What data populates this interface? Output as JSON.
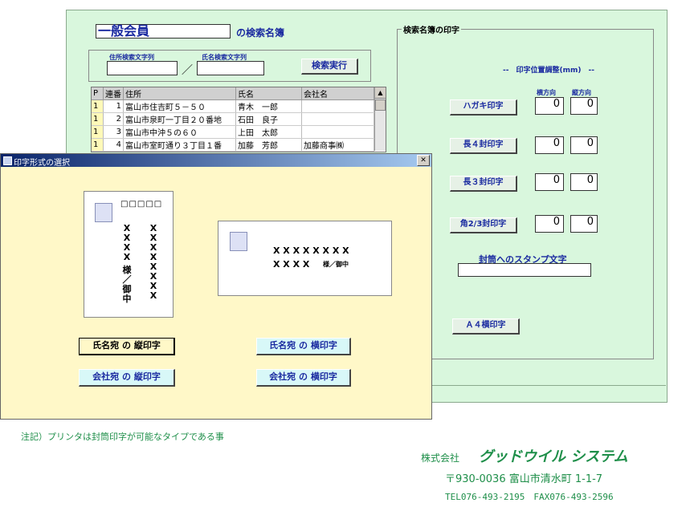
{
  "main_form": {
    "member_type": "一般会員",
    "member_suffix": "の検索名簿",
    "address_search_label": "住所検索文字列",
    "name_search_label": "氏名検索文字列",
    "slash": "／",
    "search_button": "検索実行",
    "grid": {
      "columns": [
        "P",
        "連番",
        "住所",
        "氏名",
        "会社名"
      ],
      "rows": [
        [
          "1",
          "1",
          "富山市住吉町５－５０",
          "青木　一郎",
          ""
        ],
        [
          "1",
          "2",
          "富山市泉町一丁目２０番地",
          "石田　良子",
          ""
        ],
        [
          "1",
          "3",
          "富山市中沖５の６０",
          "上田　太郎",
          ""
        ],
        [
          "1",
          "4",
          "富山市室町通り３丁目１番",
          "加藤　芳郎",
          "加藤商事㈱"
        ]
      ]
    },
    "print_panel": {
      "title": "検索名簿の印字",
      "position_header": "--　印字位置調整(mm)　--",
      "horizontal_label": "横方向",
      "vertical_label": "縦方向",
      "rows": [
        {
          "label": "ハガキ印字",
          "h": "0",
          "v": "0"
        },
        {
          "label": "長４封印字",
          "h": "0",
          "v": "0"
        },
        {
          "label": "長３封印字",
          "h": "0",
          "v": "0"
        },
        {
          "label": "角2/3封印字",
          "h": "0",
          "v": "0"
        }
      ],
      "stamp_label": "封筒へのスタンプ文字",
      "a4_button": "Ａ４横印字"
    }
  },
  "dialog": {
    "title": "印字形式の選択",
    "close": "✕",
    "postal_boxes": "□□□□□",
    "vertical_col_left": [
      "X",
      "X",
      "X",
      "X",
      "",
      "様",
      "／",
      "御",
      "中"
    ],
    "vertical_col_right": [
      "X",
      "X",
      "X",
      "X",
      "X",
      "X",
      "X",
      "X"
    ],
    "horizontal_line1": "X X X X X X X X",
    "horizontal_line2": "X X X X",
    "horizontal_suffix": "様／御中",
    "buttons": {
      "name_vertical": "氏名宛 の 縦印字",
      "name_horizontal": "氏名宛 の 横印字",
      "company_vertical": "会社宛 の 縦印字",
      "company_horizontal": "会社宛 の 横印字"
    }
  },
  "footer": {
    "note": "注記）プリンタは封筒印字が可能なタイプである事",
    "company_prefix": "株式会社",
    "company_name": "グッドウイル システム",
    "address": "〒930-0036 富山市清水町 1-1-7",
    "contact": "TEL076-493-2195　FAX076-493-2596"
  },
  "colors": {
    "form_bg": "#d9f7dd",
    "dialog_bg": "#fff8c8",
    "accent_blue": "#1a2aa0",
    "footer_green": "#1f8f4a"
  }
}
